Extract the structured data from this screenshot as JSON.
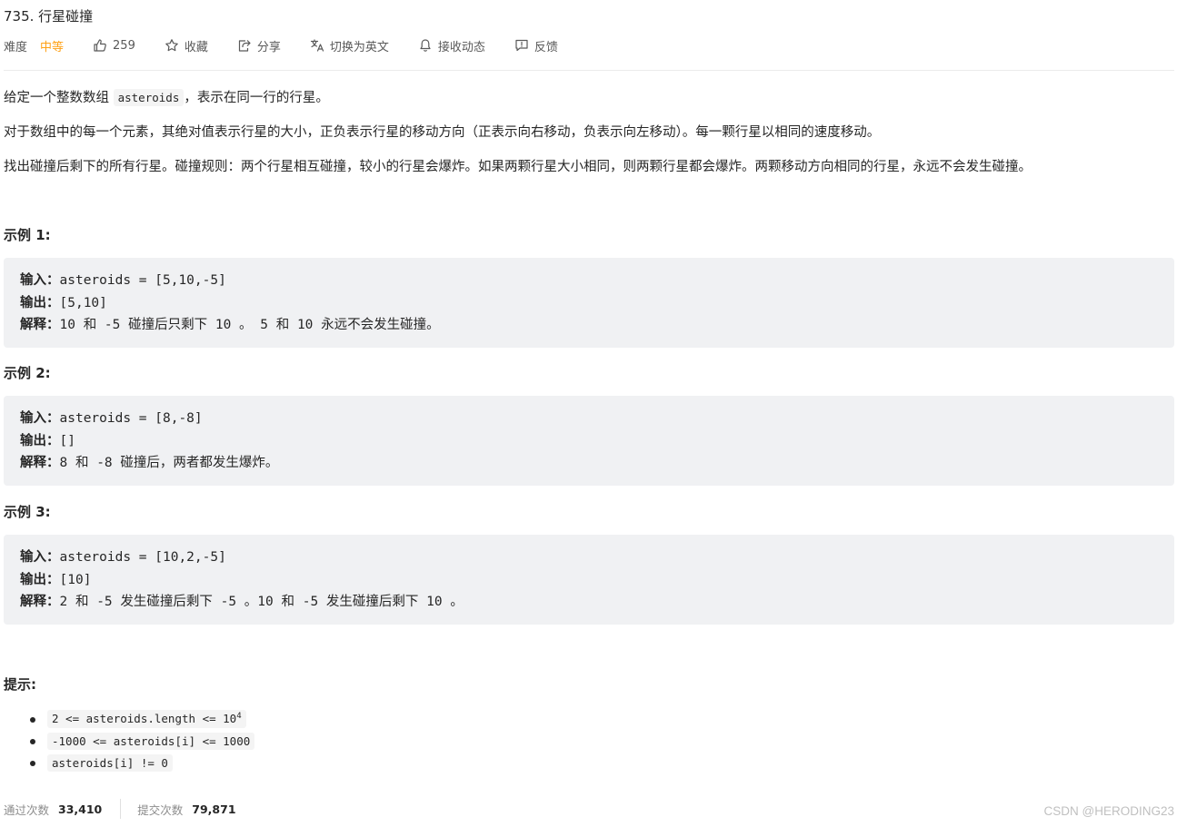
{
  "title": "735. 行星碰撞",
  "meta": {
    "difficulty_label": "难度",
    "difficulty_value": "中等",
    "like_count": "259",
    "favorite": "收藏",
    "share": "分享",
    "translate": "切换为英文",
    "subscribe": "接收动态",
    "feedback": "反馈"
  },
  "description": {
    "p1_before": "给定一个整数数组 ",
    "p1_code": "asteroids",
    "p1_after": "，表示在同一行的行星。",
    "p2": "对于数组中的每一个元素，其绝对值表示行星的大小，正负表示行星的移动方向（正表示向右移动，负表示向左移动）。每一颗行星以相同的速度移动。",
    "p3": "找出碰撞后剩下的所有行星。碰撞规则：两个行星相互碰撞，较小的行星会爆炸。如果两颗行星大小相同，则两颗行星都会爆炸。两颗移动方向相同的行星，永远不会发生碰撞。"
  },
  "labels": {
    "input": "输入：",
    "output": "输出：",
    "explain": "解释："
  },
  "examples": [
    {
      "title": "示例 1:",
      "input": "asteroids = [5,10,-5]",
      "output": "[5,10]",
      "explanation": "10 和 -5 碰撞后只剩下 10 。 5 和 10 永远不会发生碰撞。"
    },
    {
      "title": "示例 2:",
      "input": "asteroids = [8,-8]",
      "output": "[]",
      "explanation": "8 和 -8 碰撞后，两者都发生爆炸。"
    },
    {
      "title": "示例 3:",
      "input": "asteroids = [10,2,-5]",
      "output": "[10]",
      "explanation": "2 和 -5 发生碰撞后剩下 -5 。10 和 -5 发生碰撞后剩下 10 。"
    }
  ],
  "hints": {
    "title": "提示:",
    "h1_text": "2 <= asteroids.length  <= 10",
    "h1_sup": "4",
    "h2": "-1000 <= asteroids[i] <= 1000",
    "h3": "asteroids[i] != 0"
  },
  "stats": {
    "accepted_label": "通过次数",
    "accepted_value": "33,410",
    "submitted_label": "提交次数",
    "submitted_value": "79,871"
  },
  "watermark": "CSDN @HERODING23",
  "colors": {
    "difficulty_medium": "#ffa116",
    "code_block_bg": "#f0f1f3"
  }
}
